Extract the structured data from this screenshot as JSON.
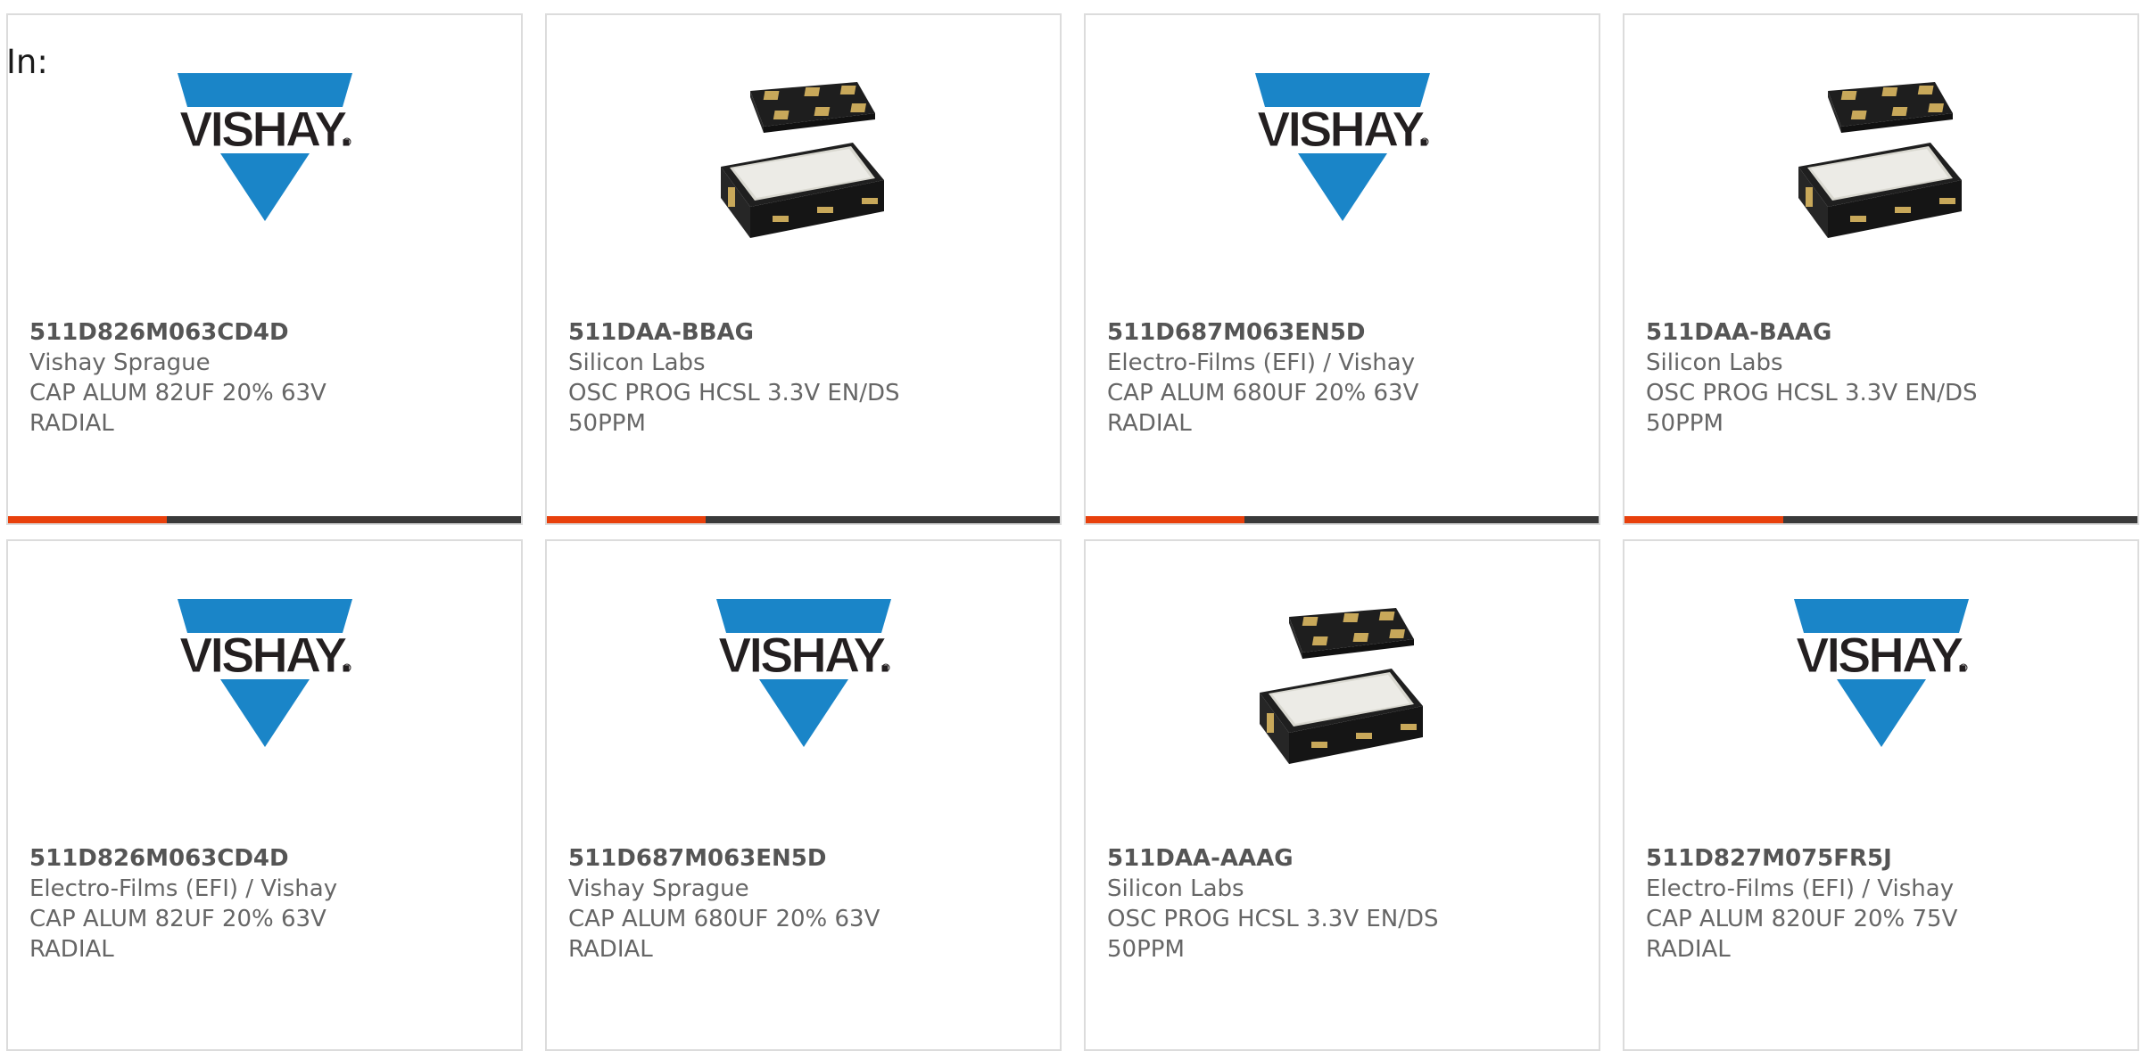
{
  "filter": {
    "label": "In:"
  },
  "colors": {
    "accent": "#e8400c",
    "track": "#3a3a3a",
    "vishay_blue": "#1a85c8",
    "border": "#dcdcdc"
  },
  "cards": [
    {
      "image": "vishay-logo",
      "part_number": "511D826M063CD4D",
      "manufacturer": "Vishay Sprague",
      "description": "CAP ALUM 82UF 20% 63V RADIAL",
      "progress": 0.31
    },
    {
      "image": "oscillator-chip",
      "part_number": "511DAA-BBAG",
      "manufacturer": "Silicon Labs",
      "description": "OSC PROG HCSL 3.3V EN/DS 50PPM",
      "progress": 0.31
    },
    {
      "image": "vishay-logo",
      "part_number": "511D687M063EN5D",
      "manufacturer": "Electro-Films (EFI) / Vishay",
      "description": "CAP ALUM 680UF 20% 63V RADIAL",
      "progress": 0.31
    },
    {
      "image": "oscillator-chip",
      "part_number": "511DAA-BAAG",
      "manufacturer": "Silicon Labs",
      "description": "OSC PROG HCSL 3.3V EN/DS 50PPM",
      "progress": 0.31
    },
    {
      "image": "vishay-logo",
      "part_number": "511D826M063CD4D",
      "manufacturer": "Electro-Films (EFI) / Vishay",
      "description": "CAP ALUM 82UF 20% 63V RADIAL"
    },
    {
      "image": "vishay-logo",
      "part_number": "511D687M063EN5D",
      "manufacturer": "Vishay Sprague",
      "description": "CAP ALUM 680UF 20% 63V RADIAL"
    },
    {
      "image": "oscillator-chip",
      "part_number": "511DAA-AAAG",
      "manufacturer": "Silicon Labs",
      "description": "OSC PROG HCSL 3.3V EN/DS 50PPM"
    },
    {
      "image": "vishay-logo",
      "part_number": "511D827M075FR5J",
      "manufacturer": "Electro-Films (EFI) / Vishay",
      "description": "CAP ALUM 820UF 20% 75V RADIAL"
    }
  ]
}
